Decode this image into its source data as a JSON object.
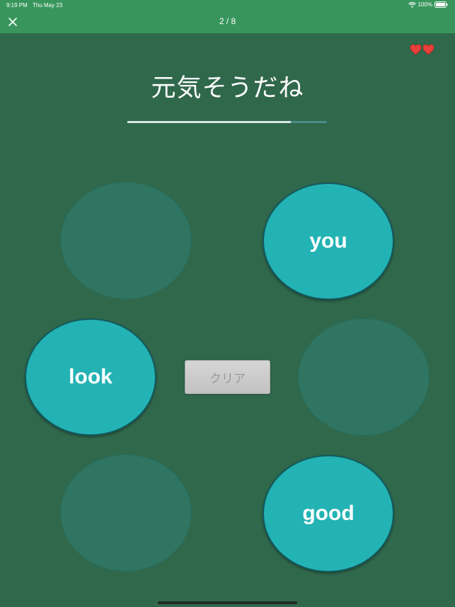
{
  "status_bar": {
    "time": "9:19 PM",
    "date": "Thu May 23",
    "battery": "100%"
  },
  "nav": {
    "close_icon": "close-icon",
    "progress": "2 / 8"
  },
  "lives": {
    "count": 2,
    "icon": "heart-icon",
    "color": "#e8403a"
  },
  "prompt": "元気そうだね",
  "timer": {
    "fraction_remaining": 0.82
  },
  "bubbles": [
    {
      "label": ""
    },
    {
      "label": "you"
    },
    {
      "label": "look"
    },
    {
      "label": ""
    },
    {
      "label": ""
    },
    {
      "label": "good"
    }
  ],
  "clear_button": {
    "label": "クリア"
  },
  "colors": {
    "header": "#38965c",
    "background": "#30684c",
    "bubble_filled": "#24b3b4",
    "bubble_empty": "#2f7561"
  }
}
